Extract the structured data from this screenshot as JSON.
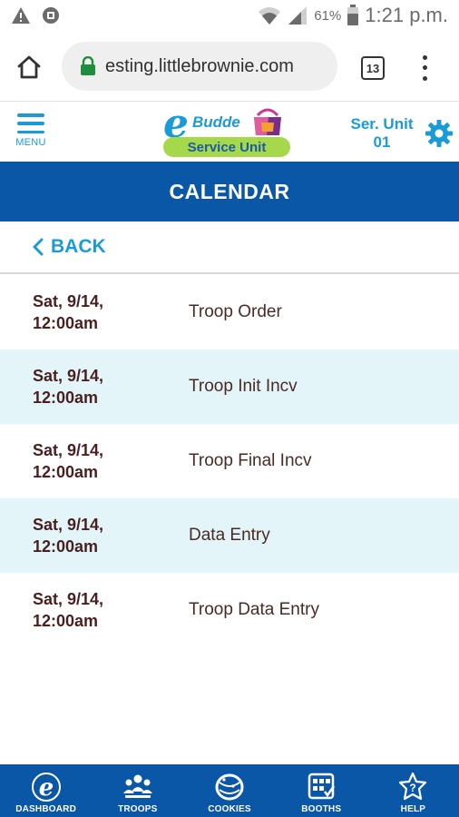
{
  "status_bar": {
    "battery_pct": "61%",
    "time": "1:21 p.m."
  },
  "browser": {
    "url": "esting.littlebrownie.com",
    "tab_count": "13"
  },
  "header": {
    "menu_label": "MENU",
    "logo_e": "e",
    "logo_word": "Budde",
    "logo_subtitle": "Service Unit",
    "unit_line1": "Ser. Unit",
    "unit_line2": "01"
  },
  "page_title": "CALENDAR",
  "back_label": "BACK",
  "events": [
    {
      "date_line1": "Sat, 9/14,",
      "date_line2": "12:00am",
      "title": "Troop Order"
    },
    {
      "date_line1": "Sat, 9/14,",
      "date_line2": "12:00am",
      "title": "Troop Init Incv"
    },
    {
      "date_line1": "Sat, 9/14,",
      "date_line2": "12:00am",
      "title": "Troop Final Incv"
    },
    {
      "date_line1": "Sat, 9/14,",
      "date_line2": "12:00am",
      "title": "Data Entry"
    },
    {
      "date_line1": "Sat, 9/14,",
      "date_line2": "12:00am",
      "title": "Troop Data Entry"
    }
  ],
  "bottom_nav": [
    {
      "label": "DASHBOARD",
      "icon": "ebudde-e-icon"
    },
    {
      "label": "TROOPS",
      "icon": "troops-icon"
    },
    {
      "label": "COOKIES",
      "icon": "cookie-icon"
    },
    {
      "label": "BOOTHS",
      "icon": "booth-icon"
    },
    {
      "label": "HELP",
      "icon": "help-icon"
    }
  ],
  "colors": {
    "brand_blue": "#0a57a7",
    "accent_cyan": "#1a9bd7",
    "alt_row": "#e4f5fa",
    "date_text": "#4a1f1f",
    "logo_green": "#a6d84b"
  }
}
